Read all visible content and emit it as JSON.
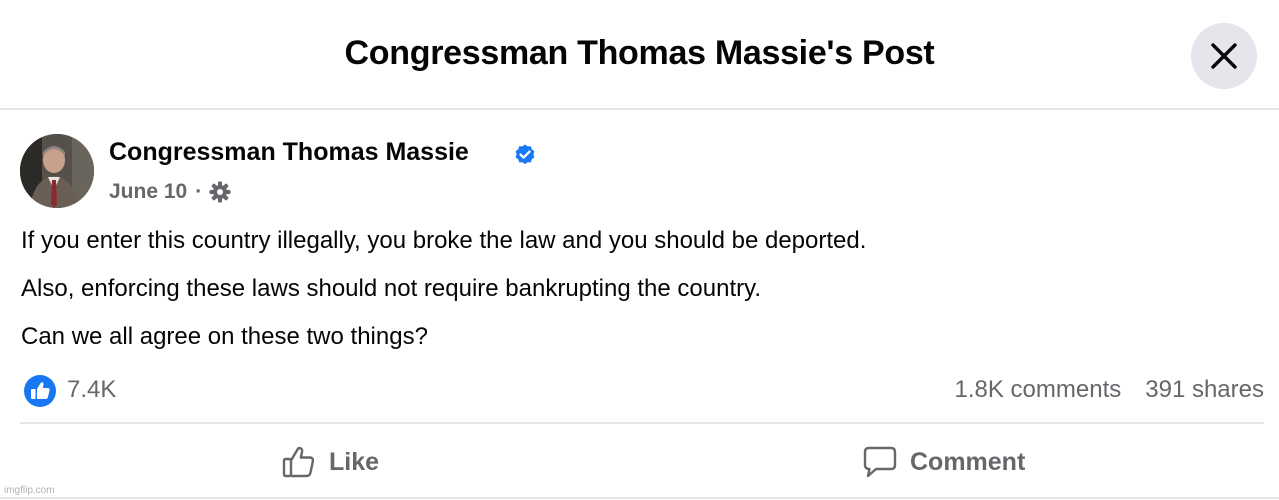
{
  "header": {
    "title": "Congressman Thomas Massie's Post"
  },
  "post": {
    "author": "Congressman Thomas Massie",
    "date": "June 10",
    "separator": "·",
    "lines": [
      "If you enter this country illegally, you broke the law and you should be deported.",
      "Also, enforcing these laws should not require bankrupting the country.",
      "Can we all agree on these two things?"
    ]
  },
  "reactions": {
    "likes": "7.4K",
    "comments": "1.8K comments",
    "shares": "391 shares"
  },
  "actions": {
    "like_label": "Like",
    "comment_label": "Comment"
  },
  "watermark": "imgflip.com",
  "icons": {
    "close": "close-icon",
    "verified": "verified-badge-icon",
    "audience": "gear-icon",
    "like_reaction": "thumbs-up-reaction-icon",
    "like_action": "thumbs-up-outline-icon",
    "comment_action": "speech-bubble-icon"
  },
  "colors": {
    "accent_blue": "#1877f2",
    "secondary_text": "#65676b",
    "divider": "#e4e6eb"
  }
}
